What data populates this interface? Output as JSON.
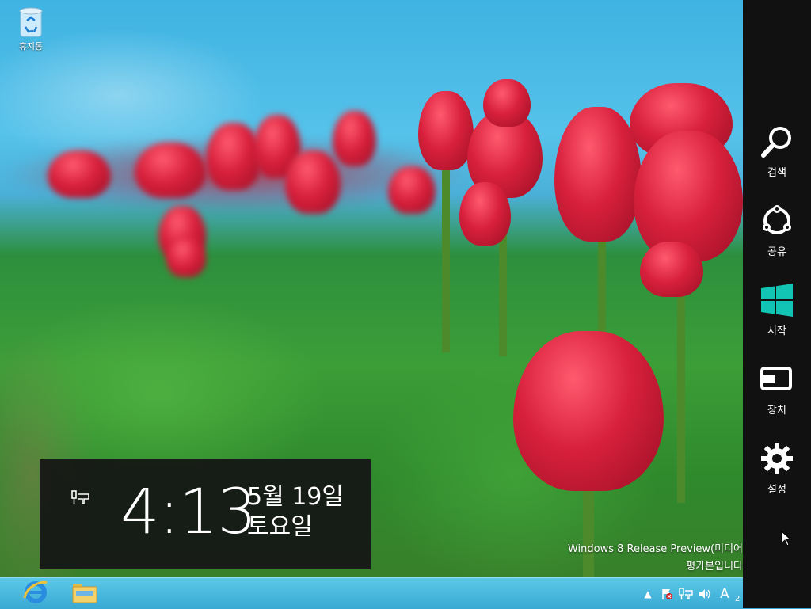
{
  "desktop": {
    "recycle_bin_label": "휴지통"
  },
  "lock_overlay": {
    "time": "4:13",
    "date_line1": "5월 19일",
    "date_line2": "토요일",
    "network_icon": "ethernet-icon"
  },
  "watermark": {
    "line1": "Windows 8 Release Preview(미디어",
    "line2": "평가본입니다"
  },
  "taskbar": {
    "pinned": [
      {
        "name": "internet-explorer",
        "icon": "ie-icon"
      },
      {
        "name": "file-explorer",
        "icon": "folder-icon"
      }
    ],
    "tray": {
      "show_hidden_icon": "▲",
      "ime_label": "A",
      "clock_partial": "2"
    }
  },
  "charms": {
    "items": [
      {
        "label": "검색",
        "icon": "search-icon"
      },
      {
        "label": "공유",
        "icon": "share-icon"
      },
      {
        "label": "시작",
        "icon": "windows-logo-icon"
      },
      {
        "label": "장치",
        "icon": "devices-icon"
      },
      {
        "label": "설정",
        "icon": "settings-icon"
      }
    ]
  },
  "colors": {
    "charms_bg": "#111111",
    "taskbar": "#3aa9d3",
    "windows_logo": "#12c4b4"
  }
}
